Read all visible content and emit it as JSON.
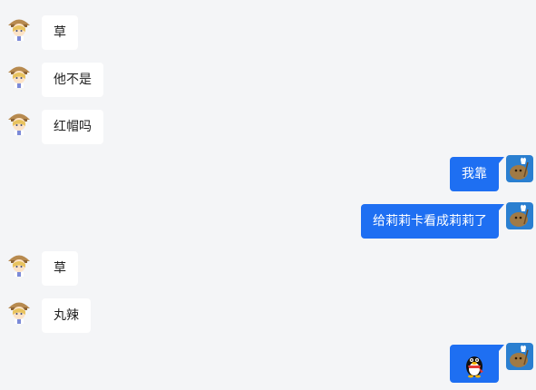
{
  "conversation": {
    "messages": [
      {
        "side": "left",
        "text": "草",
        "avatar": "girl-avatar-icon"
      },
      {
        "side": "left",
        "text": "他不是",
        "avatar": "girl-avatar-icon"
      },
      {
        "side": "left",
        "text": "红帽吗",
        "avatar": "girl-avatar-icon"
      },
      {
        "side": "right",
        "text": "我靠",
        "avatar": "potato-avatar-icon"
      },
      {
        "side": "right",
        "text": "给莉莉卡看成莉莉了",
        "avatar": "potato-avatar-icon"
      },
      {
        "side": "left",
        "text": "草",
        "avatar": "girl-avatar-icon"
      },
      {
        "side": "left",
        "text": "丸辣",
        "avatar": "girl-avatar-icon"
      },
      {
        "side": "right",
        "text": "",
        "emoji": "qq-penguin-emoji-icon",
        "avatar": "potato-avatar-icon"
      }
    ]
  },
  "colors": {
    "background": "#f4f5f7",
    "incoming_bubble": "#ffffff",
    "outgoing_bubble": "#1e6ff2",
    "outgoing_text": "#ffffff",
    "incoming_text": "#1f1f1f",
    "potato_avatar_bg": "#2a7fd0"
  }
}
